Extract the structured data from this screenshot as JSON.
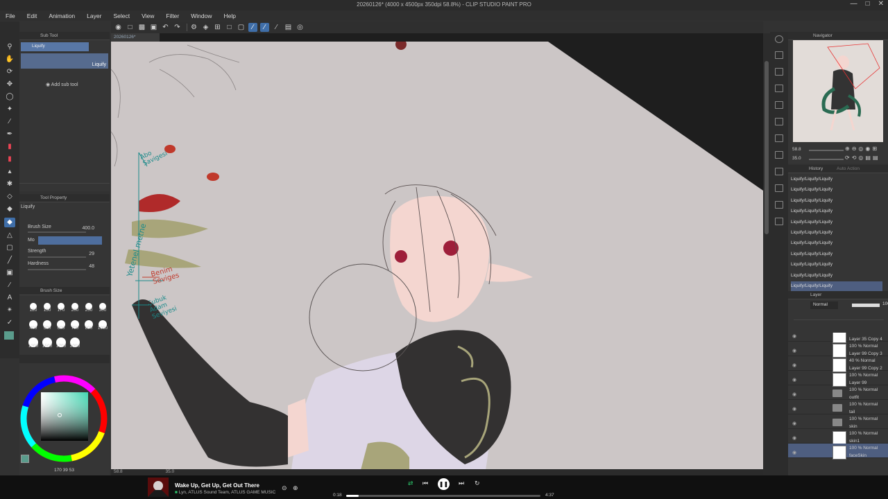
{
  "window": {
    "title": "20260126* (4000 x 4500px 350dpi 58.8%) - CLIP STUDIO PAINT PRO",
    "min_icon": "minimize-icon",
    "max_icon": "maximize-icon",
    "close_icon": "close-icon"
  },
  "menu": [
    "File",
    "Edit",
    "Animation",
    "Layer",
    "Select",
    "View",
    "Filter",
    "Window",
    "Help"
  ],
  "canvas_tab": "20260126*",
  "sub_tool": {
    "panel_title": "Sub Tool",
    "selected": "Liquify",
    "card_label": "Liquify",
    "add_label": "Add sub tool"
  },
  "tool_property": {
    "panel_title": "Tool Property",
    "tool_name": "Liquify",
    "brush_size_label": "Brush Size",
    "brush_size_value": "400.0",
    "mode_label": "Mo",
    "strength_label": "Strength",
    "strength_value": "29",
    "hardness_label": "Hardness",
    "hardness_value": "48"
  },
  "brush_size_panel": {
    "title": "Brush Size",
    "sizes": [
      "120",
      "150",
      "170",
      "200",
      "250",
      "300",
      "400",
      "500",
      "600",
      "700",
      "800",
      "1000",
      "1200",
      "1500",
      "1700",
      "2000"
    ]
  },
  "color_panel": {
    "readout": [
      "170",
      "39",
      "53"
    ]
  },
  "canvas_annotations": {
    "note1": "Abo\nSavigesi",
    "note2": "Yetenel metne",
    "note3": "Benim\nSeviges",
    "note4": "Çubuk\nAdam\nSeviyesi"
  },
  "canvas_status": {
    "zoom": "58.8",
    "angle": "35.0"
  },
  "navigator": {
    "title": "Navigator",
    "zoom": "58.8",
    "rotation": "35.0"
  },
  "history": {
    "title": "History",
    "tab2": "Auto Action",
    "items": [
      "Liquify/Liquify/Liquify",
      "Liquify/Liquify/Liquify",
      "Liquify/Liquify/Liquify",
      "Liquify/Liquify/Liquify",
      "Liquify/Liquify/Liquify",
      "Liquify/Liquify/Liquify",
      "Liquify/Liquify/Liquify",
      "Liquify/Liquify/Liquify",
      "Liquify/Liquify/Liquify",
      "Liquify/Liquify/Liquify",
      "Liquify/Liquify/Liquify"
    ]
  },
  "layer_panel": {
    "title": "Layer",
    "blend": "Normal",
    "opacity": "100",
    "layers": [
      {
        "mode": "",
        "name": "Layer 35 Copy 4",
        "type": "thumb"
      },
      {
        "mode": "100 % Normal",
        "name": "Layer 99 Copy 3",
        "type": "thumb"
      },
      {
        "mode": "40 % Normal",
        "name": "Layer 99 Copy 2",
        "type": "thumb"
      },
      {
        "mode": "100 % Normal",
        "name": "Layer 99",
        "type": "thumb"
      },
      {
        "mode": "100 % Normal",
        "name": "outfit",
        "type": "folder"
      },
      {
        "mode": "100 % Normal",
        "name": "tail",
        "type": "folder"
      },
      {
        "mode": "100 % Normal",
        "name": "skin",
        "type": "folder"
      },
      {
        "mode": "100 % Normal",
        "name": "skin1",
        "type": "thumb"
      },
      {
        "mode": "100 % Normal",
        "name": "faceSkin",
        "type": "thumb"
      }
    ]
  },
  "media": {
    "title": "Wake Up, Get Up, Get Out There",
    "artist": "Lyn, ATLUS Sound Team, ATLUS GAME MUSIC",
    "current": "0:18",
    "total": "4:37",
    "progress": 0.065
  }
}
